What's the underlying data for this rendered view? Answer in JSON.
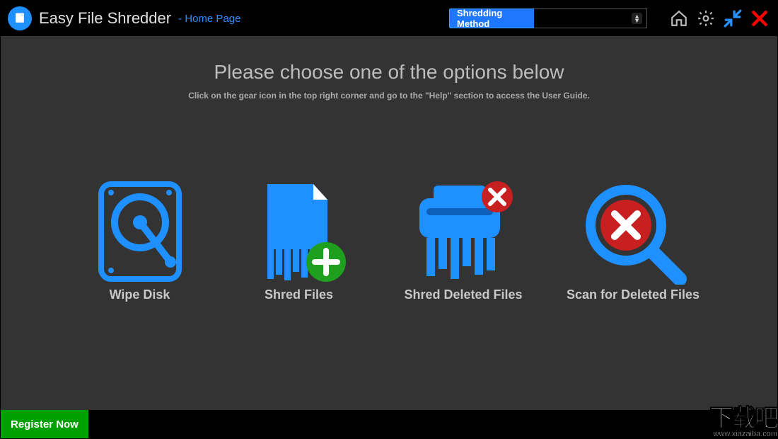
{
  "header": {
    "app_title": "Easy File Shredder",
    "page_link": "- Home Page",
    "method_label": "Shredding Method",
    "method_value": ""
  },
  "main": {
    "heading": "Please choose one of the options below",
    "subheading": "Click on the gear icon in the top right corner and go to the \"Help\" section to access the User Guide."
  },
  "options": {
    "wipe_disk": "Wipe Disk",
    "shred_files": "Shred Files",
    "shred_deleted": "Shred Deleted Files",
    "scan_deleted": "Scan for Deleted Files"
  },
  "footer": {
    "register": "Register Now"
  },
  "watermark": {
    "line1": "下载吧",
    "line2": "www.xiazaiba.com"
  },
  "colors": {
    "accent_blue": "#1e90ff",
    "accent_green": "#00a000",
    "accent_red": "#c82020"
  }
}
